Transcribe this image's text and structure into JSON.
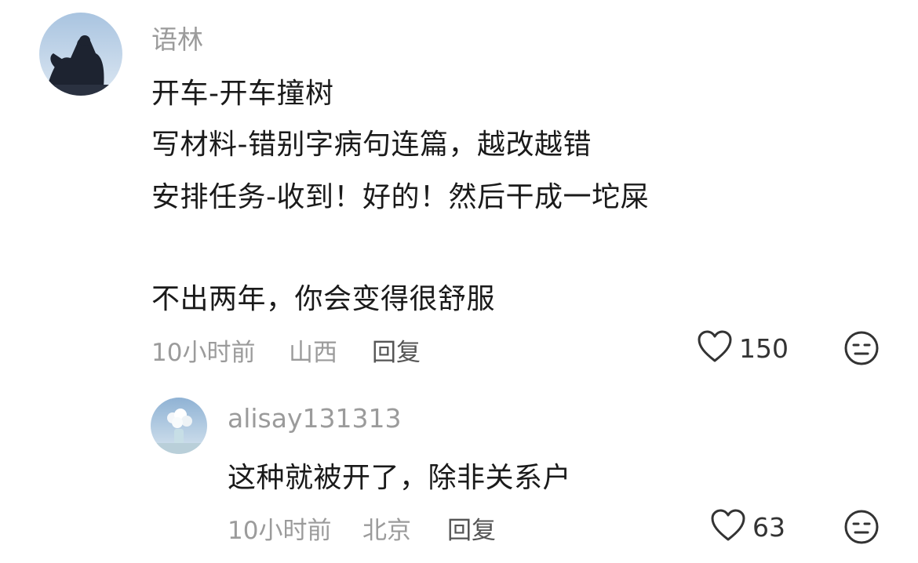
{
  "comments": [
    {
      "username": "语林",
      "content": [
        "开车-开车撞树",
        "写材料-错别字病句连篇，越改越错",
        "安排任务-收到！好的！然后干成一坨屎",
        "不出两年，你会变得很舒服"
      ],
      "time": "10小时前",
      "location": "山西",
      "reply_label": "回复",
      "likes": "150",
      "like_icon": "heart-icon",
      "dislike_icon": "meh-face-icon"
    }
  ],
  "replies": [
    {
      "username": "alisay131313",
      "content": [
        "这种就被开了，除非关系户"
      ],
      "time": "10小时前",
      "location": "北京",
      "reply_label": "回复",
      "likes": "63",
      "like_icon": "heart-icon",
      "dislike_icon": "meh-face-icon"
    }
  ],
  "colors": {
    "text": "#1a1a1a",
    "muted": "#9b9b9b",
    "icon": "#333333"
  }
}
